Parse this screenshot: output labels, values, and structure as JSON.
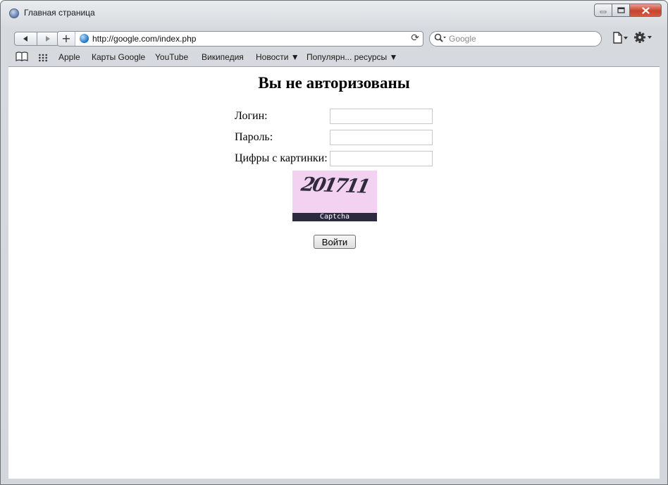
{
  "window": {
    "title": "Главная страница"
  },
  "toolbar": {
    "back_icon": "back-arrow-icon",
    "forward_icon": "forward-arrow-icon",
    "add_bookmark_symbol": "+",
    "url": "http://google.com/index.php",
    "search_placeholder": "Google"
  },
  "bookmarks": {
    "items": [
      {
        "label": "Apple"
      },
      {
        "label": "Карты Google"
      },
      {
        "label": "YouTube"
      },
      {
        "label": "Википедия"
      },
      {
        "label": "Новости ▼"
      },
      {
        "label": "Популярн... ресурсы ▼"
      }
    ]
  },
  "page": {
    "heading": "Вы не авторизованы",
    "login_label": "Логин:",
    "login_value": "",
    "password_label": "Пароль:",
    "password_value": "",
    "captcha_label": "Цифры с картинки:",
    "captcha_value": "",
    "captcha_digits": "201711",
    "captcha_caption": "Captcha",
    "submit_label": "Войти"
  },
  "colors": {
    "captcha_background": "#f2d2f0",
    "captcha_band": "#2c2a3e",
    "close_button": "#c7432b"
  }
}
